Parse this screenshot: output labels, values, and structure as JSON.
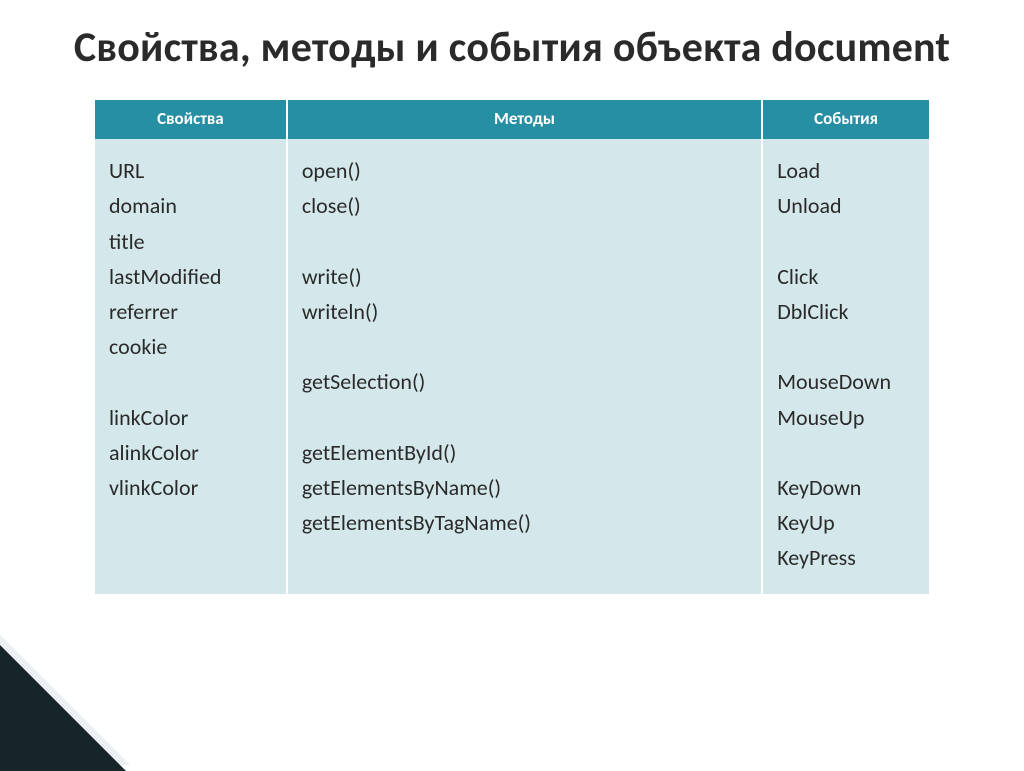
{
  "title": "Свойства, методы и события объекта document",
  "headers": {
    "props": "Свойства",
    "methods": "Методы",
    "events": "События"
  },
  "cells": {
    "props": "URL\n domain\n title\n lastModified\n referrer\n cookie\n\n linkColor\nalinkColor\nvlinkColor",
    "methods": "open()\nclose()\n\nwrite()\nwriteln()\n\ngetSelection()\n\ngetElementById()\ngetElementsByName()\ngetElementsByTagName()",
    "events": "Load\nUnload\n\nClick\nDblClick\n\nMouseDown\nMouseUp\n\nKeyDown\nKeyUp\nKeyPress"
  }
}
